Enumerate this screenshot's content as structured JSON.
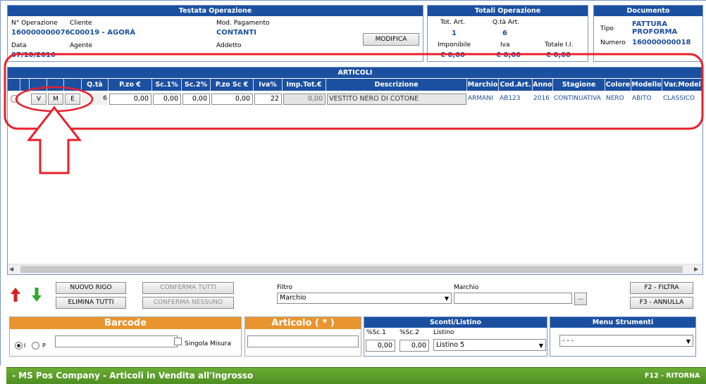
{
  "header": {
    "title": "Testata Operazione",
    "n_operazione_label": "N° Operazione",
    "n_operazione_value": "160000000076",
    "cliente_label": "Cliente",
    "cliente_value": "C00019 - AGORÀ",
    "mod_pagamento_label": "Mod. Pagamento",
    "mod_pagamento_value": "CONTANTI",
    "data_label": "Data",
    "data_value": "07/10/2016",
    "agente_label": "Agente",
    "addetto_label": "Addetto",
    "modifica_label": "MODIFICA"
  },
  "totals": {
    "title": "Totali Operazione",
    "tot_art_label": "Tot. Art.",
    "tot_art_value": "1",
    "qta_art_label": "Q.tà Art.",
    "qta_art_value": "6",
    "imponibile_label": "Imponibile",
    "imponibile_value": "€ 0,00",
    "iva_label": "Iva",
    "iva_value": "€ 0,00",
    "totale_label": "Totale I.I.",
    "totale_value": "€ 0,00"
  },
  "document": {
    "title": "Documento",
    "tipo_label": "Tipo",
    "tipo_value_1": "FATTURA",
    "tipo_value_2": "PROFORMA",
    "numero_label": "Numero",
    "numero_value": "160000000018"
  },
  "articles": {
    "title": "ARTICOLI",
    "columns": [
      "Q.tà",
      "P.zo €",
      "Sc.1%",
      "Sc.2%",
      "P.zo Sc €",
      "Iva%",
      "Imp.Tot.€",
      "Descrizione",
      "Marchio",
      "Cod.Art.",
      "Anno",
      "Stagione",
      "Colore",
      "Modello",
      "Var.Model"
    ],
    "row": {
      "btn_v": "V",
      "btn_m": "M",
      "btn_e": "E",
      "qta": "6",
      "prezzo": "0,00",
      "sc1": "0,00",
      "sc2": "0,00",
      "prezzo_sc": "0,00",
      "iva": "22",
      "imp_tot": "0,00",
      "descrizione": "VESTITO NERO DI COTONE",
      "marchio": "ARMANI",
      "cod_art": "AB123",
      "anno": "2016",
      "stagione": "CONTINUATIVA",
      "colore": "NERO",
      "modello": "ABITO",
      "var_model": "CLASSICO"
    }
  },
  "toolbar": {
    "nuovo_rigo": "NUOVO RIGO",
    "elimina_tutti": "ELIMINA TUTTI",
    "conferma_tutti": "CONFERMA TUTTI",
    "conferma_nessuno": "CONFERMA NESSUNO",
    "filtro_label": "Filtro",
    "filtro_value": "Marchio",
    "marchio_label": "Marchio",
    "marchio_value": "",
    "dots": "...",
    "f2": "F2 - FILTRA",
    "f3": "F3 - ANNULLA"
  },
  "barcode": {
    "title": "Barcode",
    "radio_i": "I",
    "radio_p": "P",
    "singola_misura": "Singola Misura",
    "value": ""
  },
  "articolo": {
    "title": "Articolo ( * )",
    "value": ""
  },
  "sconti": {
    "title": "Sconti/Listino",
    "sc1_label": "%Sc.1",
    "sc1_value": "0,00",
    "sc2_label": "%Sc.2",
    "sc2_value": "0,00",
    "listino_label": "Listino",
    "listino_value": "Listino 5"
  },
  "menu": {
    "title": "Menu Strumenti",
    "value": "- - -"
  },
  "footer": {
    "title": "- MS Pos Company - Articoli in Vendita all'Ingrosso",
    "right": "F12 - RITORNA"
  },
  "colors": {
    "header_blue": "#1b50a0",
    "annotation_red": "#e8202a",
    "footer_green": "#5a9a2a",
    "orange": "#e8952f"
  }
}
